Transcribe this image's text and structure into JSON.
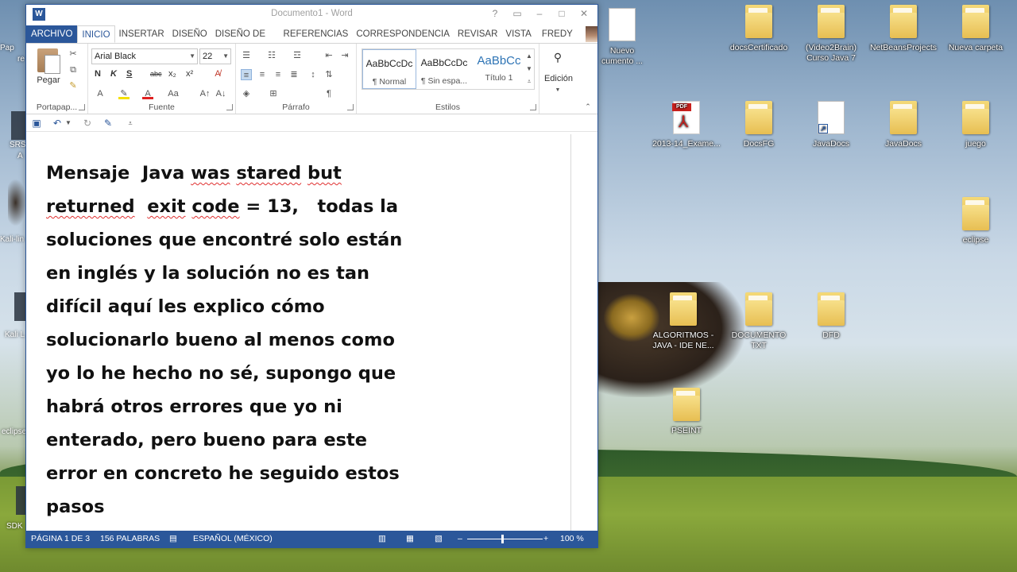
{
  "window": {
    "title": "Documento1 - Word",
    "controls": [
      "?",
      "▭",
      "–",
      "□",
      "✕"
    ]
  },
  "ribbon_tabs": {
    "file": "ARCHIVO",
    "tabs": [
      "INICIO",
      "INSERTAR",
      "DISEÑO",
      "DISEÑO DE PÁGINA",
      "REFERENCIAS",
      "CORRESPONDENCIA",
      "REVISAR",
      "VISTA"
    ],
    "active": "INICIO",
    "user": "FREDY GA..."
  },
  "clipboard": {
    "paste_label": "Pegar",
    "group_label": "Portapap..."
  },
  "font": {
    "name": "Arial Black",
    "size": "22",
    "group_label": "Fuente",
    "buttons": [
      "N",
      "K",
      "S",
      "abc",
      "x₂",
      "x²"
    ]
  },
  "paragraph": {
    "group_label": "Párrafo"
  },
  "styles": {
    "items": [
      {
        "preview": "AaBbCcDc",
        "name": "¶ Normal"
      },
      {
        "preview": "AaBbCcDc",
        "name": "¶ Sin espa..."
      },
      {
        "preview": "AaBbCc",
        "name": "Título 1"
      }
    ],
    "group_label": "Estilos"
  },
  "editing": {
    "label": "Edición"
  },
  "document": {
    "lines": [
      [
        {
          "t": "Mensaje  Java ",
          "sq": false
        },
        {
          "t": "was",
          "sq": true
        },
        {
          "t": " ",
          "sq": false
        },
        {
          "t": "stared",
          "sq": true
        },
        {
          "t": " ",
          "sq": false
        },
        {
          "t": "but",
          "sq": true
        }
      ],
      [
        {
          "t": "returned",
          "sq": true
        },
        {
          "t": "  ",
          "sq": false
        },
        {
          "t": "exit",
          "sq": true
        },
        {
          "t": " ",
          "sq": false
        },
        {
          "t": "code",
          "sq": true
        },
        {
          "t": " = 13,   todas la",
          "sq": false
        }
      ],
      [
        {
          "t": "soluciones que encontré solo están",
          "sq": false
        }
      ],
      [
        {
          "t": "en inglés y la solución no es tan",
          "sq": false
        }
      ],
      [
        {
          "t": "difícil aquí les explico cómo",
          "sq": false
        }
      ],
      [
        {
          "t": "solucionarlo bueno al menos como",
          "sq": false
        }
      ],
      [
        {
          "t": "yo lo he hecho no sé, supongo que",
          "sq": false
        }
      ],
      [
        {
          "t": "habrá otros errores que yo ni",
          "sq": false
        }
      ],
      [
        {
          "t": "enterado, pero bueno para este",
          "sq": false
        }
      ],
      [
        {
          "t": "error en concreto he seguido estos",
          "sq": false
        }
      ],
      [
        {
          "t": "pasos",
          "sq": false
        }
      ]
    ]
  },
  "status": {
    "page": "PÁGINA 1 DE 3",
    "words": "156 PALABRAS",
    "language": "ESPAÑOL (MÉXICO)",
    "zoom": "100 %",
    "zoom_minus": "–",
    "zoom_plus": "+"
  },
  "desktop": {
    "icons": [
      {
        "label": "Nuevo\ncumento ...",
        "kind": "doc"
      },
      {
        "label": "docsCertificado",
        "kind": "folder"
      },
      {
        "label": "(Video2Brain)\nCurso Java 7",
        "kind": "folder"
      },
      {
        "label": "NetBeansProjects",
        "kind": "folder"
      },
      {
        "label": "Nueva carpeta",
        "kind": "folder"
      },
      {
        "label": "2013-14_Exame...",
        "kind": "pdf"
      },
      {
        "label": "DocsFG",
        "kind": "folder"
      },
      {
        "label": "JavaDocs",
        "kind": "shortcut"
      },
      {
        "label": "JavaDocs",
        "kind": "folder"
      },
      {
        "label": "juego",
        "kind": "folder"
      },
      {
        "label": "eclipse",
        "kind": "folder"
      },
      {
        "label": "ALGORITMOS -\nJAVA - IDE NE...",
        "kind": "folder"
      },
      {
        "label": "DOCUMENTO\nTXT",
        "kind": "folder"
      },
      {
        "label": "DFD",
        "kind": "folder"
      },
      {
        "label": "PSEINT",
        "kind": "folder"
      }
    ],
    "left_labels": [
      "Pap",
      "re",
      "SRS",
      "A",
      "Kali-lin",
      "Kali L",
      "eclipse",
      "SDK"
    ]
  }
}
